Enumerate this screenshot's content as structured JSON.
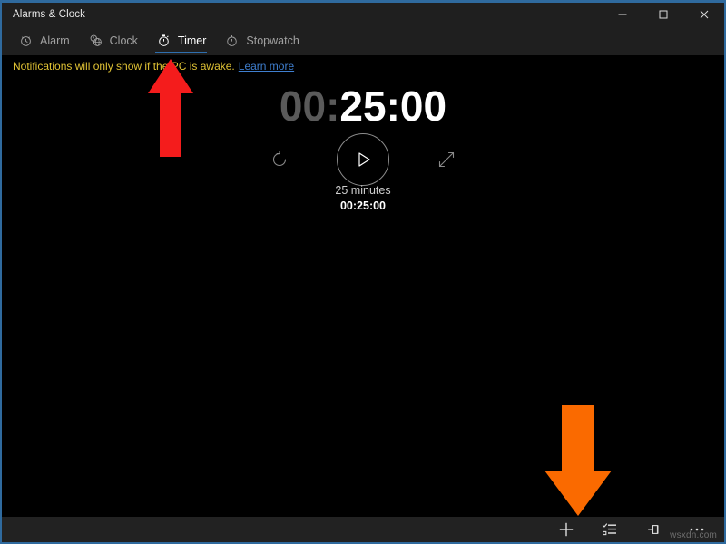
{
  "window": {
    "title": "Alarms & Clock",
    "accent_color": "#2f6fae",
    "border_color": "#2f6a9e",
    "titlebar_bg": "#1f1f1f",
    "content_bg": "#000000",
    "controls": [
      {
        "name": "minimize",
        "label": "─"
      },
      {
        "name": "maximize",
        "label": "□"
      },
      {
        "name": "close",
        "label": "✕"
      }
    ]
  },
  "tabs": [
    {
      "label": "Alarm",
      "icon": "alarm-clock-icon",
      "active": false
    },
    {
      "label": "Clock",
      "icon": "world-clock-icon",
      "active": false
    },
    {
      "label": "Timer",
      "icon": "timer-icon",
      "active": true
    },
    {
      "label": "Stopwatch",
      "icon": "stopwatch-icon",
      "active": false
    }
  ],
  "notification": {
    "text": "Notifications will only show if the PC is awake.",
    "link_label": "Learn more",
    "text_color": "#e0c234",
    "link_color": "#3f7fd0"
  },
  "timer": {
    "display_dim": "00:",
    "display_bright": "25:00",
    "name": "25 minutes",
    "duration": "00:25:00",
    "reset_icon": "reset-icon",
    "play_icon": "play-icon",
    "expand_icon": "expand-icon"
  },
  "command_bar": [
    {
      "name": "add-timer-button",
      "icon": "plus-icon",
      "label": "+"
    },
    {
      "name": "select-timers-button",
      "icon": "edit-list-icon",
      "label": "Select"
    },
    {
      "name": "pin-button",
      "icon": "pin-icon",
      "label": "Pin"
    },
    {
      "name": "more-options-button",
      "icon": "ellipsis-icon",
      "label": "…"
    }
  ],
  "watermark": "wsxdn.com",
  "annotations": [
    {
      "name": "arrow-up",
      "color": "#f41c1c",
      "direction": "up",
      "points_at": "Timer tab"
    },
    {
      "name": "arrow-down",
      "color": "#fa6a00",
      "direction": "down",
      "points_at": "Add timer button"
    }
  ]
}
